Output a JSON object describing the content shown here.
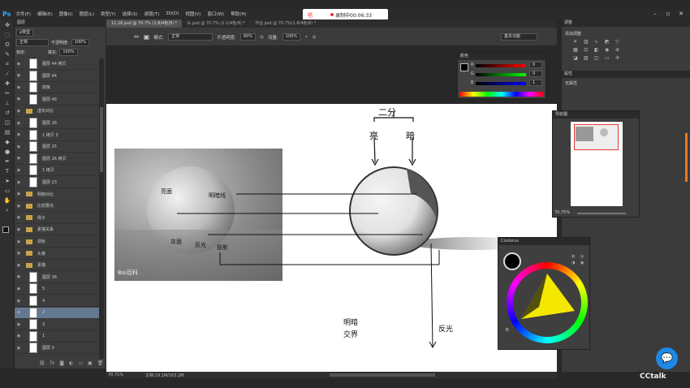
{
  "menubar": {
    "items": [
      "文件(F)",
      "编辑(E)",
      "图像(I)",
      "图层(L)",
      "类型(Y)",
      "选择(S)",
      "滤镜(T)",
      "3D(D)",
      "视图(V)",
      "窗口(W)",
      "帮助(H)"
    ],
    "logo": "Ps"
  },
  "recording": {
    "mic_label": "唱",
    "text": "录制中00:06:33"
  },
  "tabs": [
    "11.26.psd @ 70.7% (1.8/4色/8) *",
    "头.psd @ 70.7% (1.1/4色/8) *",
    "作业.psd @ 70.7%(1.8/4色/8) *"
  ],
  "options": {
    "mode_label": "模式:",
    "mode_value": "正常",
    "opacity_label": "不透明度:",
    "opacity_value": "60%",
    "flow_label": "流量:",
    "flow_value": "100%",
    "workspace": "基本功能"
  },
  "layers_panel": {
    "header": "图层",
    "filter_label": "ρ类型",
    "blend": "正常",
    "opacity_label": "不透明度:",
    "opacity_value": "100%",
    "lock_label": "锁定:",
    "fill_label": "填充:",
    "fill_value": "100%",
    "rows": [
      {
        "name": "图层 44 拷贝",
        "type": "layer"
      },
      {
        "name": "图层 44",
        "type": "layer"
      },
      {
        "name": "底板",
        "type": "layer"
      },
      {
        "name": "图层 46",
        "type": "layer"
      },
      {
        "name": "虚实对比",
        "type": "group"
      },
      {
        "name": "图层 26",
        "type": "layer"
      },
      {
        "name": "1 拷贝 3",
        "type": "layer"
      },
      {
        "name": "图层 25",
        "type": "layer"
      },
      {
        "name": "图层 26 拷贝",
        "type": "layer"
      },
      {
        "name": "1 拷贝",
        "type": "layer"
      },
      {
        "name": "图层 23",
        "type": "layer"
      },
      {
        "name": "明暗对比",
        "type": "group"
      },
      {
        "name": "比较要点",
        "type": "group"
      },
      {
        "name": "例子",
        "type": "group"
      },
      {
        "name": "素描关系",
        "type": "group"
      },
      {
        "name": "调色",
        "type": "group"
      },
      {
        "name": "头像",
        "type": "group"
      },
      {
        "name": "素描",
        "type": "group"
      },
      {
        "name": "图层 36",
        "type": "layer"
      },
      {
        "name": "5",
        "type": "layer"
      },
      {
        "name": "4",
        "type": "layer"
      },
      {
        "name": "2",
        "type": "layer",
        "selected": true
      },
      {
        "name": "3",
        "type": "layer"
      },
      {
        "name": "1",
        "type": "layer"
      },
      {
        "name": "图层 0",
        "type": "layer"
      }
    ]
  },
  "color_panel": {
    "title": "颜色",
    "r": "R",
    "g": "G",
    "b": "B",
    "r_val": "0",
    "g_val": "0",
    "b_val": "1"
  },
  "adjust_panel": {
    "title": "调整",
    "subtitle": "添加调整",
    "props_title": "属性",
    "props_value": "无属性"
  },
  "navigator": {
    "title": "导航器",
    "zoom": "70.75%"
  },
  "cyclone": {
    "title": "Coolorus"
  },
  "canvas": {
    "photo_labels": [
      "亮面",
      "明暗线",
      "灰面",
      "反光",
      "投影"
    ],
    "photo_watermark": "Bai百科",
    "annot_top": "二分",
    "annot_light": "亮",
    "annot_dark": "暗",
    "annot_bottom_left_1": "明暗",
    "annot_bottom_left_2": "交界",
    "annot_bottom_right": "反光"
  },
  "status": {
    "zoom": "70.71%",
    "doc": "文档:19.1M/163.2M"
  },
  "brand": "CCtalk",
  "accent": "#31a8ff"
}
